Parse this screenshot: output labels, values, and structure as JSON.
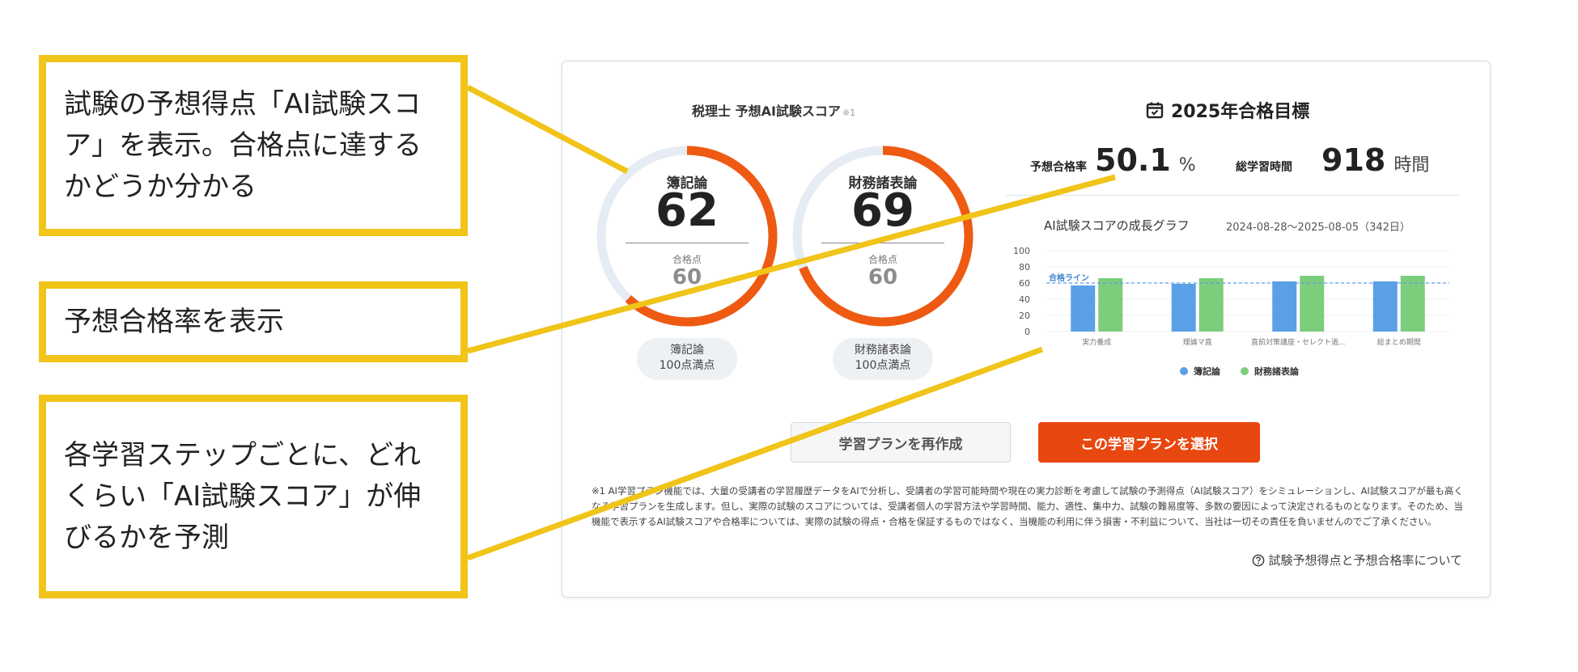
{
  "callouts": [
    {
      "text": "試験の予想得点「AI試験スコア」を表示。合格点に達するかどうか分かる"
    },
    {
      "text": "予想合格率を表示"
    },
    {
      "text": "各学習ステップごとに、どれくらい「AI試験スコア」が伸びるかを予測"
    }
  ],
  "score_section": {
    "title": "税理士 予想AI試験スコア",
    "note": "※1",
    "gauges": [
      {
        "subject": "簿記論",
        "score": "62",
        "pass_label": "合格点",
        "pass_score": "60",
        "pill_subject": "簿記論",
        "pill_max": "100点満点",
        "fraction": 0.62
      },
      {
        "subject": "財務諸表論",
        "score": "69",
        "pass_label": "合格点",
        "pass_score": "60",
        "pill_subject": "財務諸表論",
        "pill_max": "100点満点",
        "fraction": 0.69
      }
    ]
  },
  "goal": {
    "title": "2025年合格目標",
    "rate_label": "予想合格率",
    "rate_value": "50.1",
    "rate_unit": "%",
    "hours_label": "総学習時間",
    "hours_value": "918",
    "hours_unit": "時間"
  },
  "chart_data": {
    "type": "bar",
    "title": "AI試験スコアの成長グラフ",
    "range": "2024-08-28〜2025-08-05（342日）",
    "categories": [
      "実力養成",
      "理論マ直",
      "直前対策講座・セレクト過...",
      "総まとめ期間"
    ],
    "series": [
      {
        "name": "簿記論",
        "values": [
          57,
          59,
          62,
          62
        ],
        "color": "#5aa0e6"
      },
      {
        "name": "財務諸表論",
        "values": [
          66,
          66,
          69,
          69
        ],
        "color": "#7ccd7c"
      }
    ],
    "ylim": [
      0,
      100
    ],
    "yticks": [
      "0",
      "20",
      "40",
      "60",
      "80",
      "100"
    ],
    "pass_line": 60,
    "pass_line_label": "合格ライン",
    "grid": true,
    "legend": "bottom"
  },
  "buttons": {
    "remake": "学習プランを再作成",
    "select": "この学習プランを選択"
  },
  "disclaimer": "※1 AI学習プラン機能では、大量の受講者の学習履歴データをAIで分析し、受講者の学習可能時間や現在の実力診断を考慮して試験の予測得点（AI試験スコア）をシミュレーションし、AI試験スコアが最も高くなる学習プランを生成します。但し、実際の試験のスコアについては、受講者個人の学習方法や学習時間、能力、適性、集中力、試験の難易度等、多数の要因によって決定されるものとなります。そのため、当機能で表示するAI試験スコアや合格率については、実際の試験の得点・合格を保証するものではなく、当機能の利用に伴う損害・不利益について、当社は一切その責任を負いませんのでご了承ください。",
  "footer_link": "試験予想得点と予想合格率について",
  "colors": {
    "accent": "#e8470f",
    "callout_border": "#f0c419",
    "gauge_track": "#e6ecf3"
  }
}
